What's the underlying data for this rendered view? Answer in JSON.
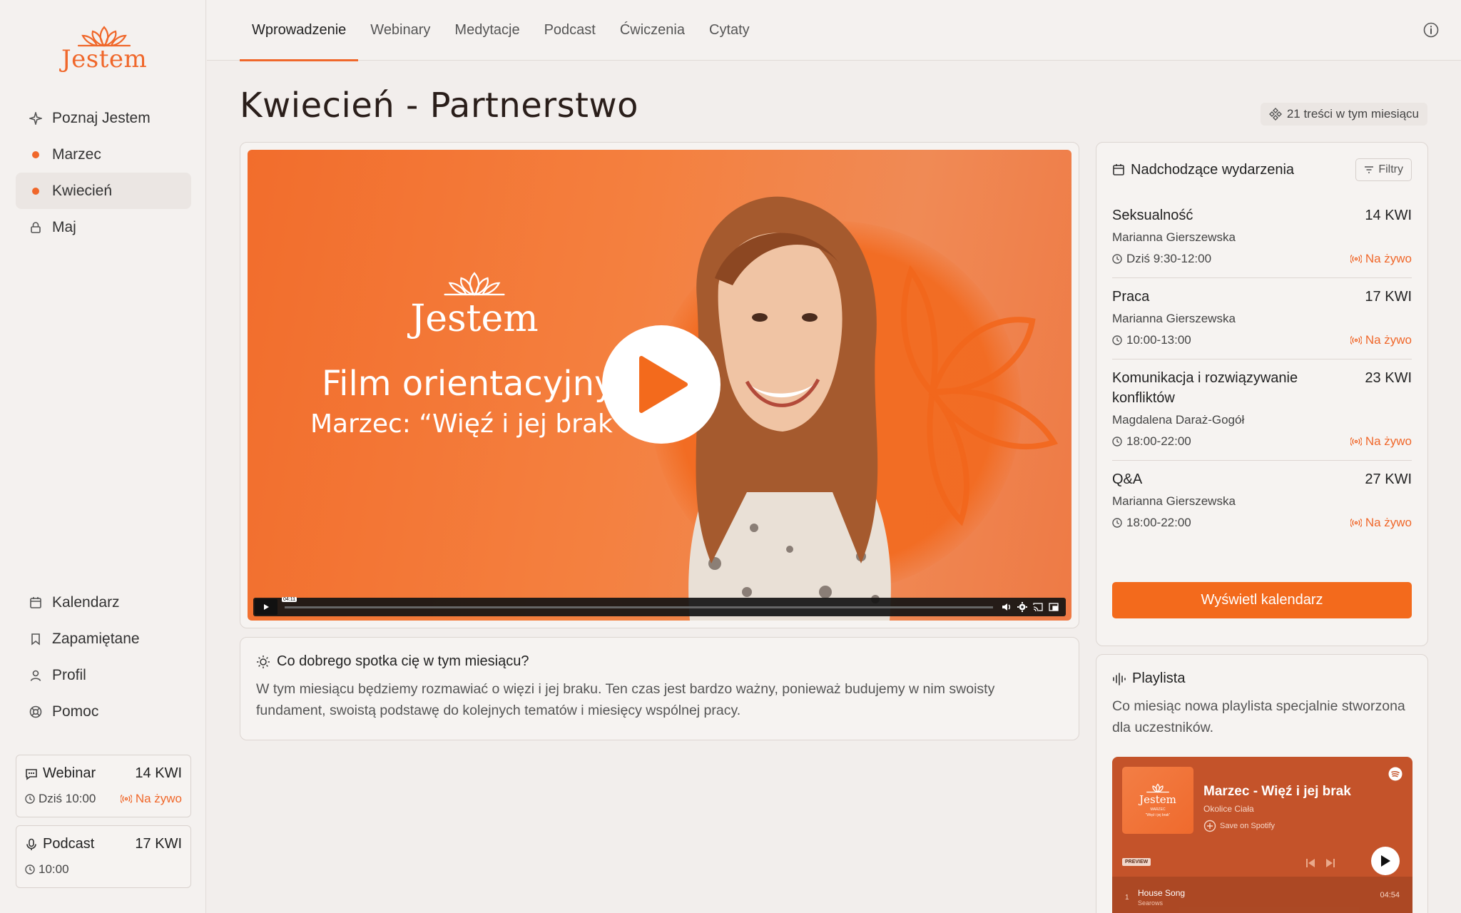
{
  "app": {
    "logo_text": "Jestem"
  },
  "sidebar": {
    "items": [
      {
        "label": "Poznaj Jestem",
        "icon": "sparkle-icon"
      },
      {
        "label": "Marzec",
        "icon": "dot-icon"
      },
      {
        "label": "Kwiecień",
        "icon": "dot-icon",
        "active": true
      },
      {
        "label": "Maj",
        "icon": "lock-icon"
      }
    ],
    "bottom_items": [
      {
        "label": "Kalendarz",
        "icon": "calendar-icon"
      },
      {
        "label": "Zapamiętane",
        "icon": "bookmark-icon"
      },
      {
        "label": "Profil",
        "icon": "user-icon"
      },
      {
        "label": "Pomoc",
        "icon": "lifebuoy-icon"
      }
    ],
    "cards": [
      {
        "title": "Webinar",
        "date": "14 KWI",
        "time": "Dziś 10:00",
        "live": "Na żywo",
        "icon": "chat-icon"
      },
      {
        "title": "Podcast",
        "date": "17 KWI",
        "time": "10:00",
        "icon": "mic-icon"
      }
    ]
  },
  "tabs": [
    {
      "label": "Wprowadzenie",
      "active": true
    },
    {
      "label": "Webinary"
    },
    {
      "label": "Medytacje"
    },
    {
      "label": "Podcast"
    },
    {
      "label": "Ćwiczenia"
    },
    {
      "label": "Cytaty"
    }
  ],
  "page": {
    "title": "Kwiecień - Partnerstwo",
    "count_badge": "21 treści w tym miesiącu"
  },
  "video": {
    "logo_text": "Jestem",
    "title": "Film orientacyjny",
    "subtitle": "Marzec: “Więź i jej brak”",
    "timestamp": "04:11"
  },
  "info": {
    "title": "Co dobrego spotka cię w tym miesiącu?",
    "text": "W tym miesiącu będziemy rozmawiać o więzi i jej braku. Ten czas jest bardzo ważny, ponieważ budujemy w nim swoisty fundament, swoistą podstawę do kolejnych tematów i miesięcy wspólnej pracy."
  },
  "events": {
    "title": "Nadchodzące wydarzenia",
    "filter_label": "Filtry",
    "items": [
      {
        "name": "Seksualność",
        "date": "14 KWI",
        "person": "Marianna Gierszewska",
        "time": "Dziś 9:30-12:00",
        "live": "Na żywo"
      },
      {
        "name": "Praca",
        "date": "17 KWI",
        "person": "Marianna Gierszewska",
        "time": "10:00-13:00",
        "live": "Na żywo"
      },
      {
        "name": "Komunikacja i rozwiązywanie konfliktów",
        "date": "23 KWI",
        "person": "Magdalena Daraż-Gogół",
        "time": "18:00-22:00",
        "live": "Na żywo"
      },
      {
        "name": "Q&A",
        "date": "27 KWI",
        "person": "Marianna Gierszewska",
        "time": "18:00-22:00",
        "live": "Na żywo"
      }
    ],
    "button_label": "Wyświetl kalendarz"
  },
  "playlist": {
    "title": "Playlista",
    "text": "Co miesiąc nowa playlista specjalnie stworzona dla uczestników.",
    "spotify": {
      "cover_text": "Jestem",
      "cover_tiny": "MARZEC",
      "cover_tiny2": "“Więź i jej brak”",
      "title": "Marzec - Więź i jej brak",
      "artist": "Okolice Ciała",
      "save_label": "Save on Spotify",
      "preview_label": "PREVIEW",
      "track_num": "1",
      "track_name": "House Song",
      "track_artist": "Searows",
      "track_duration": "04:54"
    }
  },
  "colors": {
    "accent": "#f36a1c",
    "background": "#f2eeec"
  }
}
